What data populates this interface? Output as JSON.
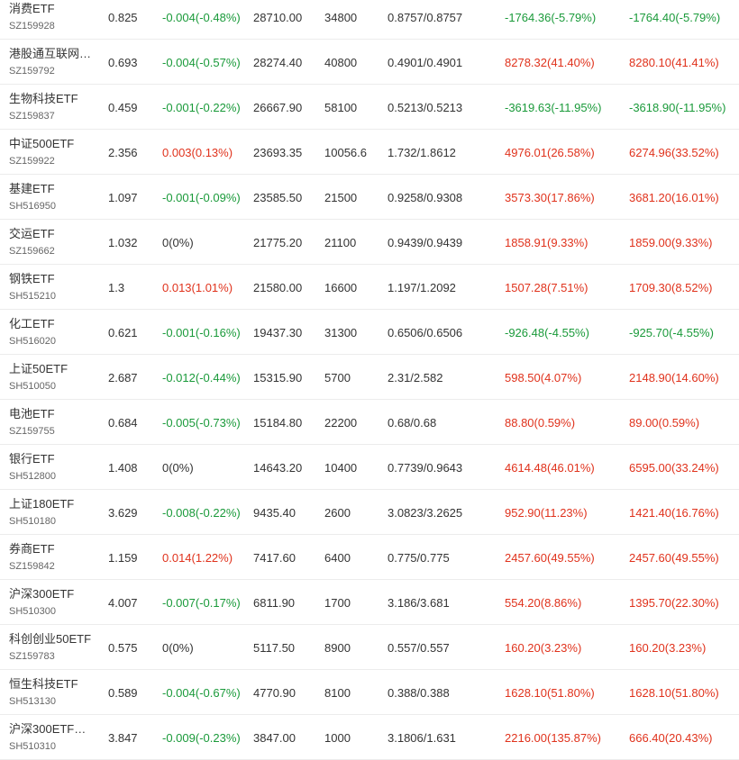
{
  "colors": {
    "down": "#1a9a3a",
    "up": "#e0321c",
    "neutral": "#333333"
  },
  "rows": [
    {
      "name": "消费ETF",
      "code": "SZ159928",
      "price": "0.825",
      "change": "-0.004(-0.48%)",
      "change_dir": "neg",
      "amount": "28710.00",
      "shares": "34800",
      "cost": "0.8757/0.8757",
      "pnl1": "-1764.36(-5.79%)",
      "pnl1_dir": "neg",
      "pnl2": "-1764.40(-5.79%)",
      "pnl2_dir": "neg"
    },
    {
      "name": "港股通互联网…",
      "code": "SZ159792",
      "price": "0.693",
      "change": "-0.004(-0.57%)",
      "change_dir": "neg",
      "amount": "28274.40",
      "shares": "40800",
      "cost": "0.4901/0.4901",
      "pnl1": "8278.32(41.40%)",
      "pnl1_dir": "pos",
      "pnl2": "8280.10(41.41%)",
      "pnl2_dir": "pos"
    },
    {
      "name": "生物科技ETF",
      "code": "SZ159837",
      "price": "0.459",
      "change": "-0.001(-0.22%)",
      "change_dir": "neg",
      "amount": "26667.90",
      "shares": "58100",
      "cost": "0.5213/0.5213",
      "pnl1": "-3619.63(-11.95%)",
      "pnl1_dir": "neg",
      "pnl2": "-3618.90(-11.95%)",
      "pnl2_dir": "neg"
    },
    {
      "name": "中证500ETF",
      "code": "SZ159922",
      "price": "2.356",
      "change": "0.003(0.13%)",
      "change_dir": "pos",
      "amount": "23693.35",
      "shares": "10056.6",
      "cost": "1.732/1.8612",
      "pnl1": "4976.01(26.58%)",
      "pnl1_dir": "pos",
      "pnl2": "6274.96(33.52%)",
      "pnl2_dir": "pos"
    },
    {
      "name": "基建ETF",
      "code": "SH516950",
      "price": "1.097",
      "change": "-0.001(-0.09%)",
      "change_dir": "neg",
      "amount": "23585.50",
      "shares": "21500",
      "cost": "0.9258/0.9308",
      "pnl1": "3573.30(17.86%)",
      "pnl1_dir": "pos",
      "pnl2": "3681.20(16.01%)",
      "pnl2_dir": "pos"
    },
    {
      "name": "交运ETF",
      "code": "SZ159662",
      "price": "1.032",
      "change": "0(0%)",
      "change_dir": "neutral",
      "amount": "21775.20",
      "shares": "21100",
      "cost": "0.9439/0.9439",
      "pnl1": "1858.91(9.33%)",
      "pnl1_dir": "pos",
      "pnl2": "1859.00(9.33%)",
      "pnl2_dir": "pos"
    },
    {
      "name": "钢铁ETF",
      "code": "SH515210",
      "price": "1.3",
      "change": "0.013(1.01%)",
      "change_dir": "pos",
      "amount": "21580.00",
      "shares": "16600",
      "cost": "1.197/1.2092",
      "pnl1": "1507.28(7.51%)",
      "pnl1_dir": "pos",
      "pnl2": "1709.30(8.52%)",
      "pnl2_dir": "pos"
    },
    {
      "name": "化工ETF",
      "code": "SH516020",
      "price": "0.621",
      "change": "-0.001(-0.16%)",
      "change_dir": "neg",
      "amount": "19437.30",
      "shares": "31300",
      "cost": "0.6506/0.6506",
      "pnl1": "-926.48(-4.55%)",
      "pnl1_dir": "neg",
      "pnl2": "-925.70(-4.55%)",
      "pnl2_dir": "neg"
    },
    {
      "name": "上证50ETF",
      "code": "SH510050",
      "price": "2.687",
      "change": "-0.012(-0.44%)",
      "change_dir": "neg",
      "amount": "15315.90",
      "shares": "5700",
      "cost": "2.31/2.582",
      "pnl1": "598.50(4.07%)",
      "pnl1_dir": "pos",
      "pnl2": "2148.90(14.60%)",
      "pnl2_dir": "pos"
    },
    {
      "name": "电池ETF",
      "code": "SZ159755",
      "price": "0.684",
      "change": "-0.005(-0.73%)",
      "change_dir": "neg",
      "amount": "15184.80",
      "shares": "22200",
      "cost": "0.68/0.68",
      "pnl1": "88.80(0.59%)",
      "pnl1_dir": "pos",
      "pnl2": "89.00(0.59%)",
      "pnl2_dir": "pos"
    },
    {
      "name": "银行ETF",
      "code": "SH512800",
      "price": "1.408",
      "change": "0(0%)",
      "change_dir": "neutral",
      "amount": "14643.20",
      "shares": "10400",
      "cost": "0.7739/0.9643",
      "pnl1": "4614.48(46.01%)",
      "pnl1_dir": "pos",
      "pnl2": "6595.00(33.24%)",
      "pnl2_dir": "pos"
    },
    {
      "name": "上证180ETF",
      "code": "SH510180",
      "price": "3.629",
      "change": "-0.008(-0.22%)",
      "change_dir": "neg",
      "amount": "9435.40",
      "shares": "2600",
      "cost": "3.0823/3.2625",
      "pnl1": "952.90(11.23%)",
      "pnl1_dir": "pos",
      "pnl2": "1421.40(16.76%)",
      "pnl2_dir": "pos"
    },
    {
      "name": "券商ETF",
      "code": "SZ159842",
      "price": "1.159",
      "change": "0.014(1.22%)",
      "change_dir": "pos",
      "amount": "7417.60",
      "shares": "6400",
      "cost": "0.775/0.775",
      "pnl1": "2457.60(49.55%)",
      "pnl1_dir": "pos",
      "pnl2": "2457.60(49.55%)",
      "pnl2_dir": "pos"
    },
    {
      "name": "沪深300ETF",
      "code": "SH510300",
      "price": "4.007",
      "change": "-0.007(-0.17%)",
      "change_dir": "neg",
      "amount": "6811.90",
      "shares": "1700",
      "cost": "3.186/3.681",
      "pnl1": "554.20(8.86%)",
      "pnl1_dir": "pos",
      "pnl2": "1395.70(22.30%)",
      "pnl2_dir": "pos"
    },
    {
      "name": "科创创业50ETF",
      "code": "SZ159783",
      "price": "0.575",
      "change": "0(0%)",
      "change_dir": "neutral",
      "amount": "5117.50",
      "shares": "8900",
      "cost": "0.557/0.557",
      "pnl1": "160.20(3.23%)",
      "pnl1_dir": "pos",
      "pnl2": "160.20(3.23%)",
      "pnl2_dir": "pos"
    },
    {
      "name": "恒生科技ETF",
      "code": "SH513130",
      "price": "0.589",
      "change": "-0.004(-0.67%)",
      "change_dir": "neg",
      "amount": "4770.90",
      "shares": "8100",
      "cost": "0.388/0.388",
      "pnl1": "1628.10(51.80%)",
      "pnl1_dir": "pos",
      "pnl2": "1628.10(51.80%)",
      "pnl2_dir": "pos"
    },
    {
      "name": "沪深300ETF…",
      "code": "SH510310",
      "price": "3.847",
      "change": "-0.009(-0.23%)",
      "change_dir": "neg",
      "amount": "3847.00",
      "shares": "1000",
      "cost": "3.1806/1.631",
      "pnl1": "2216.00(135.87%)",
      "pnl1_dir": "pos",
      "pnl2": "666.40(20.43%)",
      "pnl2_dir": "pos"
    }
  ]
}
